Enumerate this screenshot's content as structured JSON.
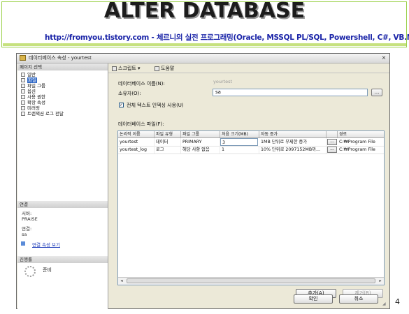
{
  "slide": {
    "title": "ALTER DATABASE",
    "subtitle": "http://fromyou.tistory.com - 체르니의 실전 프로그래밍(Oracle, MSSQL PL/SQL, Powershell, C#, VB.NET)",
    "page_number": "4",
    "accent_color": "#9bd14a"
  },
  "dialog": {
    "title": "데이터베이스 속성 - yourtest",
    "close_glyph": "×",
    "left_panel": {
      "header": "페이지 선택",
      "pages": [
        {
          "label": "일반",
          "icon": "page-icon"
        },
        {
          "label": "파일",
          "icon": "page-icon",
          "selected": true
        },
        {
          "label": "파일 그룹",
          "icon": "page-icon"
        },
        {
          "label": "옵션",
          "icon": "page-icon"
        },
        {
          "label": "사용 권한",
          "icon": "page-icon"
        },
        {
          "label": "확장 속성",
          "icon": "page-icon"
        },
        {
          "label": "미러링",
          "icon": "page-icon"
        },
        {
          "label": "트랜잭션 로그 전달",
          "icon": "page-icon"
        }
      ],
      "connection": {
        "header": "연결",
        "server_label": "서버:",
        "server_value": "PRAISE",
        "conn_label": "연결:",
        "conn_value": "sa",
        "view_props_link": "연결 속성 보기"
      },
      "progress": {
        "header": "진행률",
        "status": "준비"
      }
    },
    "toolbar": {
      "script_label": "스크립트",
      "help_label": "도움말"
    },
    "form": {
      "db_name_label": "데이터베이스 이름(N):",
      "db_name_value": "yourtest",
      "owner_label": "소유자(O):",
      "owner_value": "sa",
      "browse_label": "...",
      "fulltext_label": "전체 텍스트 인덱싱 사용(U)",
      "fulltext_checked": "✓",
      "files_label": "데이터베이스 파일(F):"
    },
    "grid": {
      "columns": [
        "논리적 이름",
        "파일 유형",
        "파일 그룹",
        "처음 크기(MB)",
        "자동 증가",
        "",
        "경로"
      ],
      "rows": [
        {
          "logical_name": "yourtest",
          "file_type": "데이터",
          "filegroup": "PRIMARY",
          "initial_size": "3",
          "autogrowth": "1MB 단위로 무제한 증가",
          "btn": "...",
          "path": "C:₩Program File"
        },
        {
          "logical_name": "yourtest_log",
          "file_type": "로그",
          "filegroup": "해당 사항 없음",
          "initial_size": "1",
          "autogrowth": "10% 단위로 2097152MB까...",
          "btn": "...",
          "path": "C:₩Program File"
        }
      ],
      "scroll_left": "◂",
      "scroll_right": "▸"
    },
    "buttons": {
      "add": "추가(A)",
      "remove": "제거(R)",
      "ok": "확인",
      "cancel": "취소"
    }
  }
}
